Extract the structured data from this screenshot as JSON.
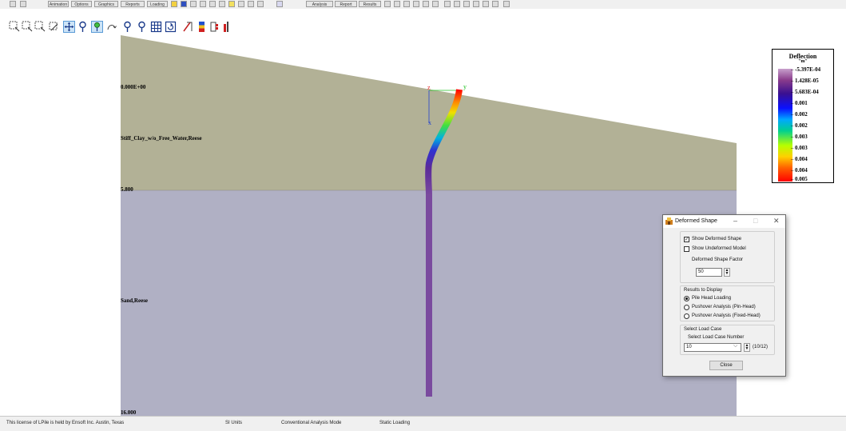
{
  "toolbar_top": {
    "items": [
      "Animation",
      "Options",
      "Graphics",
      "Reports",
      "Loading",
      "Analysis",
      "Report",
      "Results"
    ]
  },
  "toolbar_view": {
    "icons": [
      "select-x-icon",
      "select-y-icon",
      "select-z-icon",
      "select-3d-icon",
      "pan-icon",
      "pin-icon",
      "pin-green-icon",
      "rotate-icon",
      "pin-a-icon",
      "pin-b-icon",
      "grid-icon",
      "refresh-icon",
      "scale-icon",
      "color-bar-icon",
      "section-icon",
      "flag-icon"
    ]
  },
  "viewport": {
    "layers": [
      {
        "name": "Stiff_Clay_w/o_Free_Water,Reese",
        "top_label": "0.000E+00",
        "color": "#b2b196"
      },
      {
        "name": "Sand,Reese",
        "top_label": "5.800",
        "color": "#b0b0c4"
      }
    ],
    "bottom_label": "16.000",
    "axes": {
      "x": "x",
      "y": "y",
      "z": "z"
    }
  },
  "legend": {
    "title": "Deflection",
    "unit": "\"m\"",
    "labels": [
      "-5.397E-04",
      "1.428E-05",
      "5.683E-04",
      "0.001",
      "0.002",
      "0.002",
      "0.003",
      "0.003",
      "0.004",
      "0.004",
      "0.005"
    ]
  },
  "dialog": {
    "title": "Deformed Shape",
    "show_deformed_label": "Show Deformed Shape",
    "show_deformed_checked": true,
    "show_undeformed_label": "Show Undeformed Model",
    "show_undeformed_checked": false,
    "factor_label": "Deformed Shape Factor",
    "factor_value": "50",
    "results_group_label": "Results to Display",
    "results_options": [
      "Pile Head Loading",
      "Pushover Analysis (Pin-Head)",
      "Pushover Analysis (Fixed-Head)"
    ],
    "results_selected": "Pile Head Loading",
    "loadcase_group_label": "Select Load Case",
    "loadcase_label": "Select Load Case Number",
    "loadcase_value": "10",
    "loadcase_count": "(10/12)",
    "close_label": "Close"
  },
  "status_bar": {
    "license": "This license of LPile is held by Ensoft Inc. Austin, Texas",
    "units": "SI Units",
    "mode": "Conventional Analysis Mode",
    "loading": "Static Loading"
  }
}
